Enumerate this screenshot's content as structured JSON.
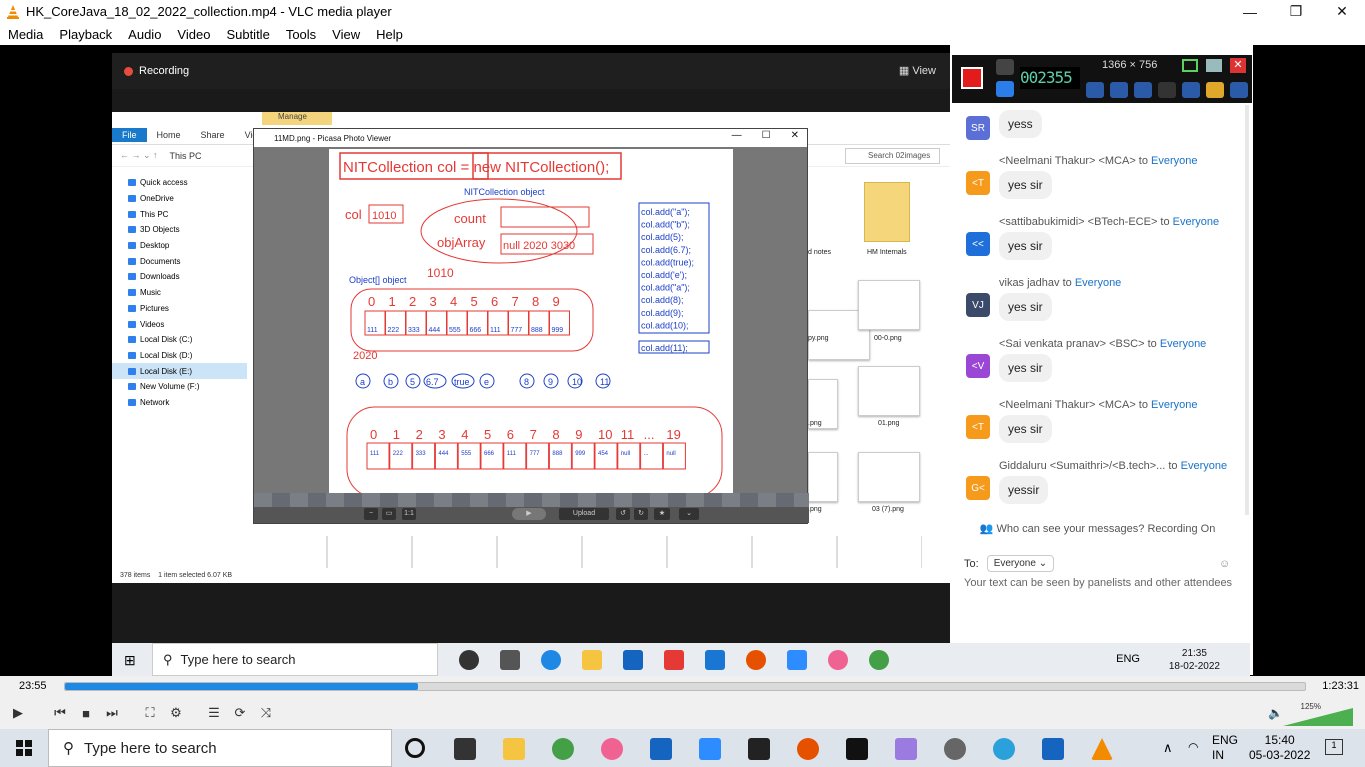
{
  "window": {
    "title": "HK_CoreJava_18_02_2022_collection.mp4 - VLC media player"
  },
  "menu": [
    "Media",
    "Playback",
    "Audio",
    "Video",
    "Subtitle",
    "Tools",
    "View",
    "Help"
  ],
  "zoom": {
    "recording": "Recording",
    "view": "View"
  },
  "explorer": {
    "manage": "Manage",
    "tabs": [
      "File",
      "Home",
      "Share",
      "View"
    ],
    "path": "This PC",
    "search": "Search 02images",
    "nav": [
      "Quick access",
      "OneDrive",
      "This PC",
      "3D Objects",
      "Desktop",
      "Documents",
      "Downloads",
      "Music",
      "Pictures",
      "Videos",
      "Local Disk (C:)",
      "Local Disk (D:)",
      "Local Disk (E:)",
      "New Volume (F:)",
      "Network"
    ],
    "status_items": "378 items",
    "status_sel": "1 item selected  6.07 KB",
    "files": [
      "d notes",
      "HM Internals",
      "py.png",
      "00-0.png",
      ".png",
      "01.png",
      ".png",
      "03 (7).png"
    ]
  },
  "picasa": {
    "title": "11MD.png - Picasa Photo Viewer",
    "upload": "Upload",
    "slide": {
      "heading": "NITCollection col = new NITCollection();",
      "obj_label": "NITCollection object",
      "col": "col",
      "col_addr": "1010",
      "count": "count",
      "objArray": "objArray",
      "arr_val": "null 2020 3030",
      "addr1010": "1010",
      "object_label": "Object[] object",
      "addr2020": "2020",
      "top_idx": [
        "0",
        "1",
        "2",
        "3",
        "4",
        "5",
        "6",
        "7",
        "8",
        "9"
      ],
      "top_vals": [
        "111",
        "222",
        "333",
        "444",
        "555",
        "666",
        "111",
        "777",
        "888",
        "999"
      ],
      "circles": [
        "a",
        "b",
        "5",
        "6.7",
        "true",
        "e",
        "8",
        "9",
        "10",
        "11"
      ],
      "bottom_idx": [
        "0",
        "1",
        "2",
        "3",
        "4",
        "5",
        "6",
        "7",
        "8",
        "9",
        "10",
        "11",
        "...",
        "19"
      ],
      "bottom_vals": [
        "111",
        "222",
        "333",
        "444",
        "555",
        "666",
        "111",
        "777",
        "888",
        "999",
        "454",
        "null",
        "...",
        "null"
      ],
      "adds": [
        "col.add(\"a\");",
        "col.add(\"b\");",
        "col.add(5);",
        "col.add(6.7);",
        "col.add(true);",
        "col.add('e');",
        "col.add(\"a\");",
        "col.add(8);",
        "col.add(9);",
        "col.add(10);"
      ],
      "add11": "col.add(11);"
    }
  },
  "recorder": {
    "time": "002355",
    "resolution": "1366 × 756"
  },
  "chat": {
    "messages": [
      {
        "avatar": "SR",
        "color": "#5b6fd6",
        "sender": "",
        "to": "",
        "text": "yess"
      },
      {
        "avatar": "<T",
        "color": "#f59a1b",
        "sender": "<Neelmani Thakur> <MCA> to ",
        "to": "Everyone",
        "text": "yes sir"
      },
      {
        "avatar": "<<",
        "color": "#1e6fd9",
        "sender": "<sattibabukimidi> <BTech-ECE> to ",
        "to": "Everyone",
        "text": "yes sir"
      },
      {
        "avatar": "VJ",
        "color": "#3b4a6b",
        "sender": "vikas jadhav to ",
        "to": "Everyone",
        "text": "yes sir"
      },
      {
        "avatar": "<V",
        "color": "#9b47d6",
        "sender": "<Sai venkata pranav> <BSC> to ",
        "to": "Everyone",
        "text": "yes sir"
      },
      {
        "avatar": "<T",
        "color": "#f59a1b",
        "sender": "<Neelmani Thakur> <MCA> to ",
        "to": "Everyone",
        "text": "yes sir"
      },
      {
        "avatar": "G<",
        "color": "#f59a1b",
        "sender": "Giddaluru <Sumaithri>/<B.tech>... to ",
        "to": "Everyone",
        "text": "yessir"
      }
    ],
    "who": "Who can see your messages? Recording On",
    "to_label": "To:",
    "to_value": "Everyone",
    "input_placeholder": "Your text can be seen by panelists and other attendees"
  },
  "inner_taskbar": {
    "search": "Type here to search",
    "lang": "ENG",
    "time": "21:35",
    "date": "18-02-2022"
  },
  "player": {
    "elapsed": "23:55",
    "total": "1:23:31",
    "progress": 0.285,
    "volume": "125%"
  },
  "taskbar": {
    "search": "Type here to search",
    "lang": "ENG",
    "lang2": "IN",
    "time": "15:40",
    "date": "05-03-2022",
    "notif": "1"
  }
}
